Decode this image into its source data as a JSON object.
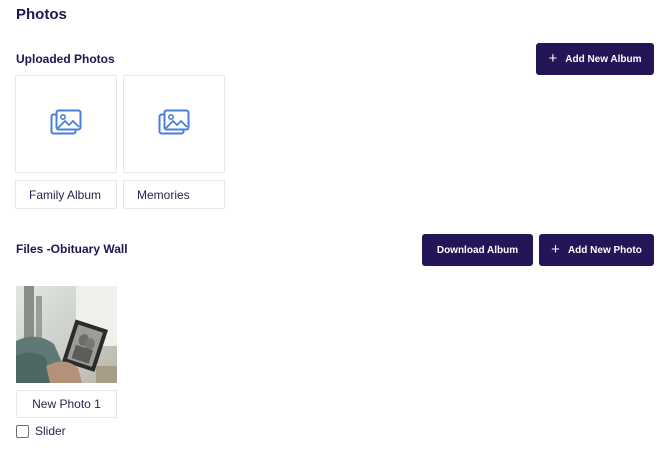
{
  "page": {
    "title": "Photos"
  },
  "uploaded": {
    "title": "Uploaded Photos",
    "add_album_label": "Add New Album",
    "albums": [
      {
        "name": "Family Album",
        "icon": "image-gallery-icon"
      },
      {
        "name": "Memories",
        "icon": "image-gallery-icon"
      }
    ]
  },
  "files": {
    "title": "Files -Obituary Wall",
    "download_label": "Download Album",
    "add_photo_label": "Add New Photo",
    "photos": [
      {
        "name": "New Photo 1",
        "slider_label": "Slider",
        "slider_checked": false
      }
    ]
  },
  "colors": {
    "primary": "#231556",
    "heading": "#1e1650",
    "icon": "#4a7fd8",
    "border": "#e6e6ec"
  }
}
